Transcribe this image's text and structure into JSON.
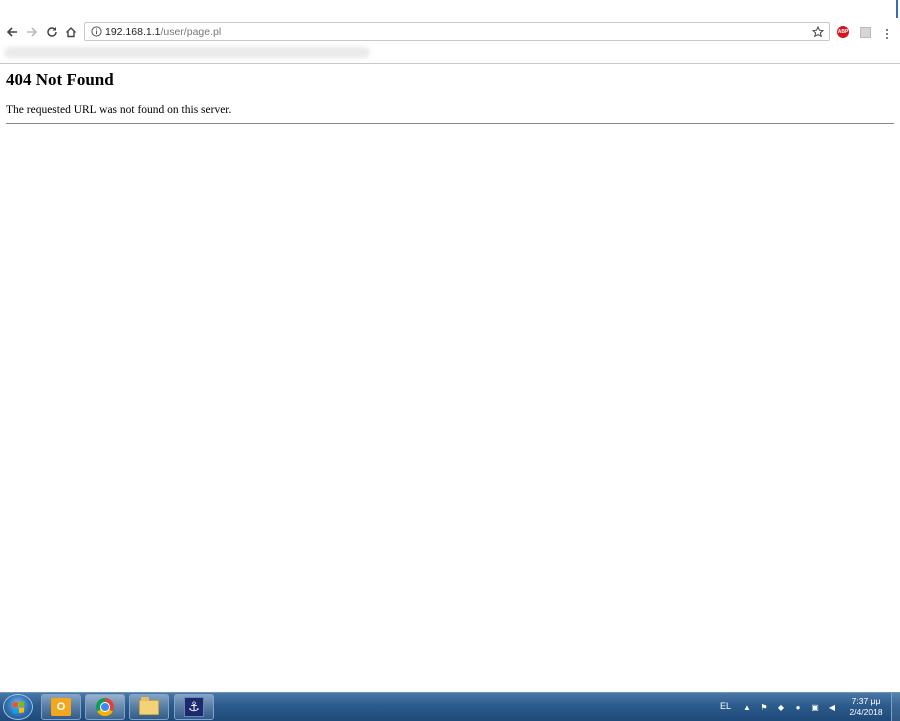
{
  "browser": {
    "url_host": "192.168.1.1",
    "url_path": "/user/page.pl",
    "extensions": {
      "adblock_label": "ABP"
    }
  },
  "page": {
    "heading": "404 Not Found",
    "message": "The requested URL was not found on this server."
  },
  "taskbar": {
    "language": "EL",
    "clock_time": "7:37 μμ",
    "clock_date": "2/4/2018",
    "outlook_label": "O",
    "pinned": [
      "outlook-icon",
      "chrome-icon",
      "folder-icon",
      "app-icon"
    ]
  },
  "colors": {
    "taskbar": "#2b5a8c",
    "abp": "#d7141a"
  }
}
